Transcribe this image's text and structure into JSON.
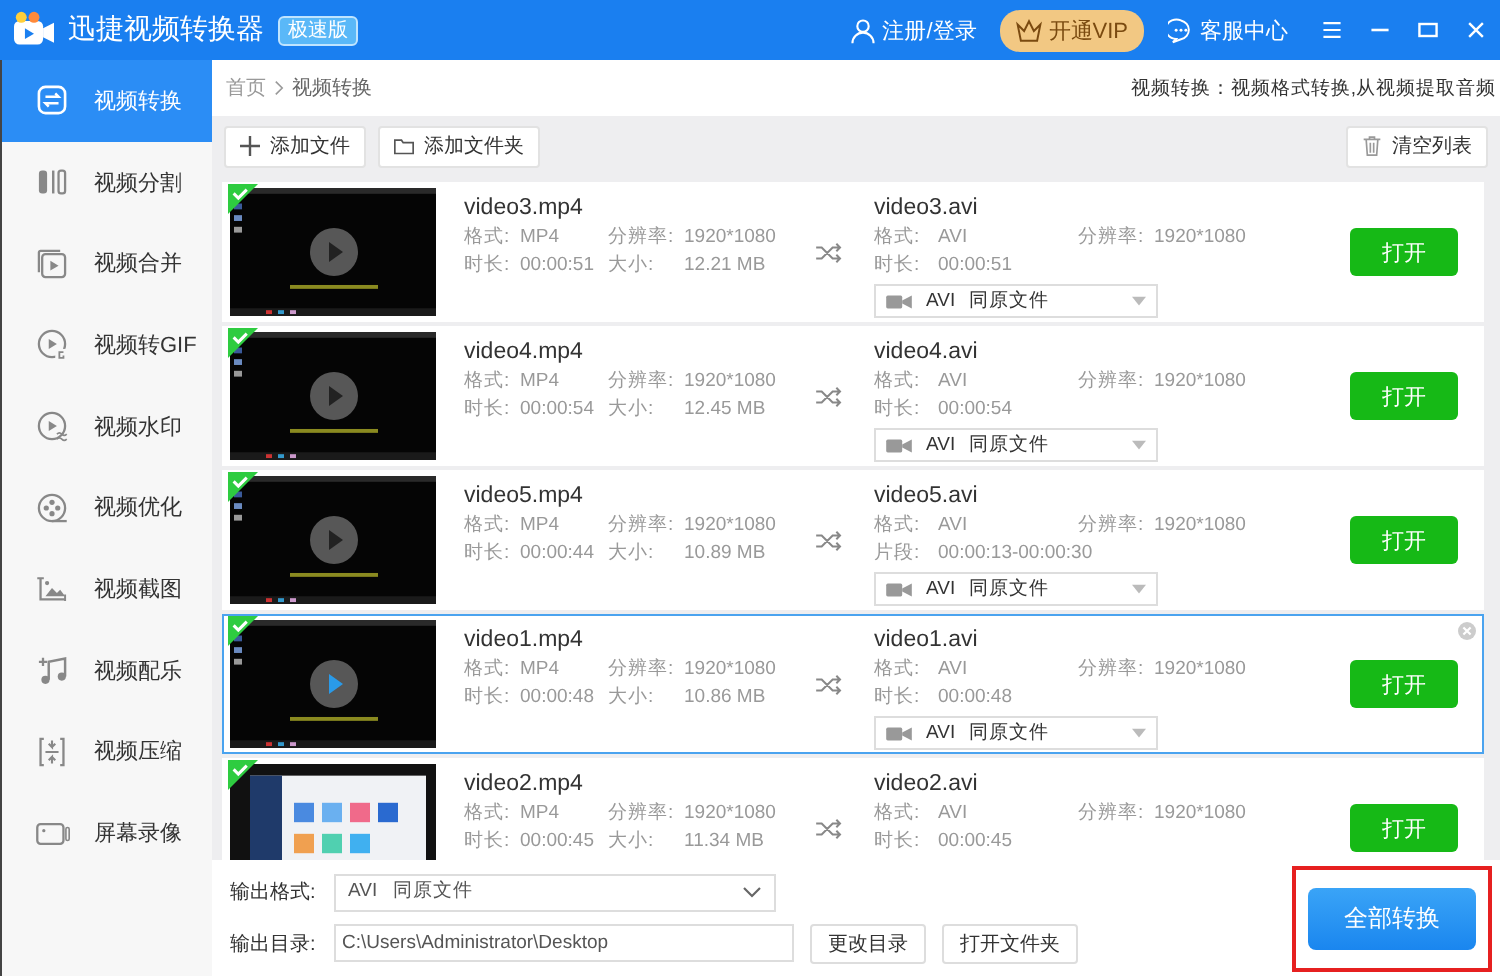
{
  "window": {
    "title": "迅捷视频转换器",
    "badge": "极速版"
  },
  "header_actions": [
    {
      "kind": "user",
      "label": "注册/登录"
    },
    {
      "kind": "vip",
      "label": "开通VIP"
    },
    {
      "kind": "chat",
      "label": "客服中心"
    }
  ],
  "sidebar": {
    "items": [
      {
        "label": "视频转换",
        "selected": true
      },
      {
        "label": "视频分割",
        "selected": false
      },
      {
        "label": "视频合并",
        "selected": false
      },
      {
        "label": "视频转GIF",
        "selected": false
      },
      {
        "label": "视频水印",
        "selected": false
      },
      {
        "label": "视频优化",
        "selected": false
      },
      {
        "label": "视频截图",
        "selected": false
      },
      {
        "label": "视频配乐",
        "selected": false
      },
      {
        "label": "视频压缩",
        "selected": false
      },
      {
        "label": "屏幕录像",
        "selected": false
      }
    ]
  },
  "breadcrumb": [
    "首页",
    "视频转换"
  ],
  "description": "视频转换：视频格式转换,从视频提取音频",
  "toolbar": {
    "add_file": "添加文件",
    "add_folder": "添加文件夹",
    "clear": "清空列表"
  },
  "files": [
    {
      "checked": true,
      "selected": false,
      "play_button": true,
      "name": "video3.mp4",
      "format_label": "格式:",
      "format": "MP4",
      "resolution_label": "分辨率:",
      "resolution": "1920*1080",
      "duration_label": "时长:",
      "duration": "00:00:51",
      "size_label": "大小:",
      "size": "12.21 MB",
      "output": {
        "name": "video3.avi",
        "format_label": "格式:",
        "format": "AVI",
        "resolution_label": "分辨率:",
        "resolution": "1920*1080",
        "time_label": "时长:",
        "time": "00:00:51",
        "dropdown": {
          "format": "AVI",
          "quality": "同原文件"
        }
      },
      "open_button": "打开"
    },
    {
      "checked": true,
      "selected": false,
      "play_button": true,
      "name": "video4.mp4",
      "format_label": "格式:",
      "format": "MP4",
      "resolution_label": "分辨率:",
      "resolution": "1920*1080",
      "duration_label": "时长:",
      "duration": "00:00:54",
      "size_label": "大小:",
      "size": "12.45 MB",
      "output": {
        "name": "video4.avi",
        "format_label": "格式:",
        "format": "AVI",
        "resolution_label": "分辨率:",
        "resolution": "1920*1080",
        "time_label": "时长:",
        "time": "00:00:54",
        "dropdown": {
          "format": "AVI",
          "quality": "同原文件"
        }
      },
      "open_button": "打开"
    },
    {
      "checked": true,
      "selected": false,
      "play_button": true,
      "name": "video5.mp4",
      "format_label": "格式:",
      "format": "MP4",
      "resolution_label": "分辨率:",
      "resolution": "1920*1080",
      "duration_label": "时长:",
      "duration": "00:00:44",
      "size_label": "大小:",
      "size": "10.89 MB",
      "output": {
        "name": "video5.avi",
        "format_label": "格式:",
        "format": "AVI",
        "resolution_label": "分辨率:",
        "resolution": "1920*1080",
        "time_label": "片段:",
        "time": "00:00:13-00:00:30",
        "dropdown": {
          "format": "AVI",
          "quality": "同原文件"
        }
      },
      "open_button": "打开"
    },
    {
      "checked": true,
      "selected": true,
      "play_button": true,
      "name": "video1.mp4",
      "format_label": "格式:",
      "format": "MP4",
      "resolution_label": "分辨率:",
      "resolution": "1920*1080",
      "duration_label": "时长:",
      "duration": "00:00:48",
      "size_label": "大小:",
      "size": "10.86 MB",
      "output": {
        "name": "video1.avi",
        "format_label": "格式:",
        "format": "AVI",
        "resolution_label": "分辨率:",
        "resolution": "1920*1080",
        "time_label": "时长:",
        "time": "00:00:48",
        "dropdown": {
          "format": "AVI",
          "quality": "同原文件"
        }
      },
      "open_button": "打开"
    },
    {
      "checked": true,
      "selected": false,
      "play_button": false,
      "name": "video2.mp4",
      "format_label": "格式:",
      "format": "MP4",
      "resolution_label": "分辨率:",
      "resolution": "1920*1080",
      "duration_label": "时长:",
      "duration": "00:00:45",
      "size_label": "大小:",
      "size": "11.34 MB",
      "output": {
        "name": "video2.avi",
        "format_label": "格式:",
        "format": "AVI",
        "resolution_label": "分辨率:",
        "resolution": "1920*1080",
        "time_label": "时长:",
        "time": "00:00:45"
      },
      "open_button": "打开"
    }
  ],
  "output_format": {
    "label": "输出格式:",
    "format": "AVI",
    "quality": "同原文件"
  },
  "output_dir": {
    "label": "输出目录:",
    "value": "C:\\Users\\Administrator\\Desktop",
    "change_button": "更改目录",
    "open_button": "打开文件夹"
  },
  "convert_all": {
    "label": "全部转换",
    "highlighted": true
  }
}
